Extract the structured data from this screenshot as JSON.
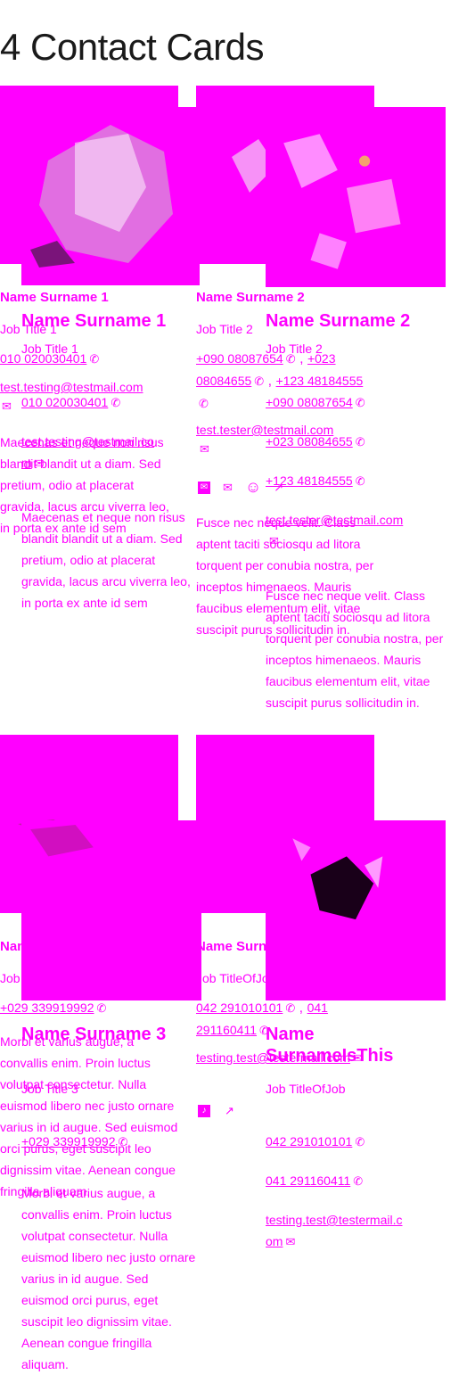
{
  "page": {
    "title": "4 Contact Cards"
  },
  "colors": {
    "accent": "#ff00ff",
    "heading": "#1a1a1a"
  },
  "icons": {
    "phone": "✆",
    "mail": "✉",
    "smiley": "☺",
    "external": "↗",
    "tiktok": "♪"
  },
  "cards": [
    {
      "name": "Name Surname 1",
      "job": "Job Title 1",
      "phones": [
        "010 020030401"
      ],
      "email": "test.testing@testmail.com",
      "email_wrapped_a": "test.testing@testmail.co",
      "email_wrapped_b": "m",
      "description": "Maecenas et neque non risus blandit blandit ut a diam. Sed pretium, odio at placerat gravida, lacus arcu viverra leo, in porta ex ante id sem"
    },
    {
      "name": "Name Surname 2",
      "job": "Job Title 2",
      "phones": [
        "+090 08087654",
        "+023 08084655",
        "+123 48184555"
      ],
      "email": "test.tester@testmail.com",
      "description": "Fusce nec neque velit. Class aptent taciti sociosqu ad litora torquent per conubia nostra, per inceptos himenaeos. Mauris faucibus elementum elit, vitae suscipit purus sollicitudin in."
    },
    {
      "name": "Name Surname 3",
      "job": "Job Title 3",
      "phones": [
        "+029 339919992"
      ],
      "email": "",
      "description": "Morbi et varius augue, a convallis enim. Proin luctus volutpat consectetur. Nulla euismod libero nec justo ornare varius in id augue. Sed euismod orci purus, eget suscipit leo dignissim vitae. Aenean congue fringilla aliquam."
    },
    {
      "name": "Name SurnameIsThis",
      "name_line1": "Name",
      "name_line2": "SurnameIsThis",
      "job": "Job TitleOfJob",
      "phones": [
        "042 291010101",
        "041 291160411"
      ],
      "email": "testing.test@testermail.com",
      "email_wrapped_a": "testing.test@testermail.c",
      "email_wrapped_b": "om"
    }
  ]
}
